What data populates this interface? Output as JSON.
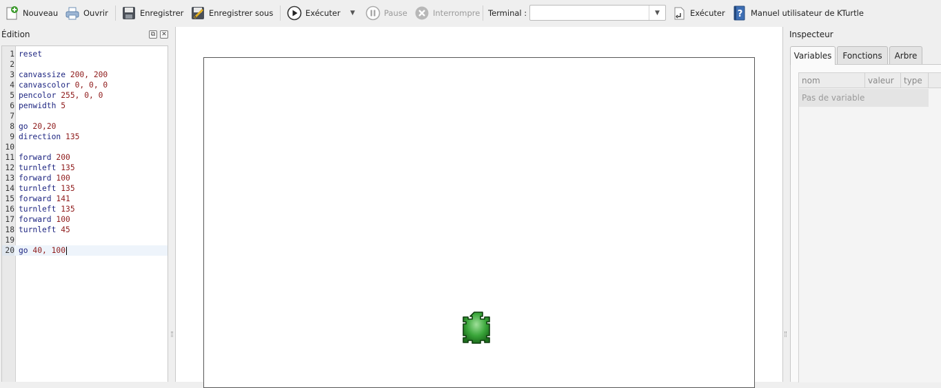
{
  "toolbar": {
    "new_label": "Nouveau",
    "open_label": "Ouvrir",
    "save_label": "Enregistrer",
    "save_as_label": "Enregistrer sous",
    "run_label": "Exécuter",
    "pause_label": "Pause",
    "stop_label": "Interrompre",
    "terminal_label": "Terminal :",
    "terminal_value": "",
    "terminal_run_label": "Exécuter",
    "manual_label": "Manuel utilisateur de KTurtle"
  },
  "editor": {
    "title": "Édition",
    "current_line": 20,
    "lines": [
      {
        "n": "1",
        "kw": "reset",
        "args": ""
      },
      {
        "n": "2",
        "kw": "",
        "args": ""
      },
      {
        "n": "3",
        "kw": "canvassize",
        "args": " 200, 200"
      },
      {
        "n": "4",
        "kw": "canvascolor",
        "args": " 0, 0, 0"
      },
      {
        "n": "5",
        "kw": "pencolor",
        "args": " 255, 0, 0"
      },
      {
        "n": "6",
        "kw": "penwidth",
        "args": " 5"
      },
      {
        "n": "7",
        "kw": "",
        "args": ""
      },
      {
        "n": "8",
        "kw": "go",
        "args": " 20,20"
      },
      {
        "n": "9",
        "kw": "direction",
        "args": " 135"
      },
      {
        "n": "10",
        "kw": "",
        "args": ""
      },
      {
        "n": "11",
        "kw": "forward",
        "args": " 200"
      },
      {
        "n": "12",
        "kw": "turnleft",
        "args": " 135"
      },
      {
        "n": "13",
        "kw": "forward",
        "args": " 100"
      },
      {
        "n": "14",
        "kw": "turnleft",
        "args": " 135"
      },
      {
        "n": "15",
        "kw": "forward",
        "args": " 141"
      },
      {
        "n": "16",
        "kw": "turnleft",
        "args": " 135"
      },
      {
        "n": "17",
        "kw": "forward",
        "args": " 100"
      },
      {
        "n": "18",
        "kw": "turnleft",
        "args": " 45"
      },
      {
        "n": "19",
        "kw": "",
        "args": ""
      },
      {
        "n": "20",
        "kw": "go",
        "args": " 40, 100"
      }
    ]
  },
  "inspector": {
    "title": "Inspecteur",
    "tabs": [
      "Variables",
      "Fonctions",
      "Arbre"
    ],
    "active_tab": "Variables",
    "columns": [
      "nom",
      "valeur",
      "type"
    ],
    "empty_text": "Pas de variable"
  },
  "colors": {
    "turtle_green": "#2e9a2e",
    "keyword": "#1d2581",
    "number": "#8e1a1a"
  }
}
